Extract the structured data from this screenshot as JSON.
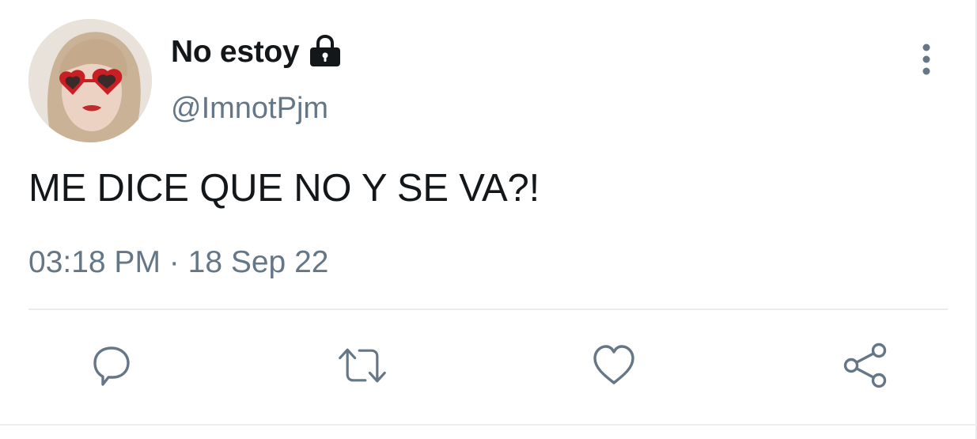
{
  "user": {
    "display_name": "No estoy",
    "handle": "@ImnotPjm",
    "protected_icon": "lock-icon",
    "avatar": "avatar-photo"
  },
  "tweet": {
    "text": "ME DICE QUE NO Y SE VA?!",
    "time": "03:18 PM",
    "separator": "·",
    "date": "18 Sep 22"
  },
  "actions": {
    "reply_icon": "reply-icon",
    "retweet_icon": "retweet-icon",
    "like_icon": "heart-icon",
    "share_icon": "share-icon",
    "more_icon": "more-vertical-icon"
  },
  "colors": {
    "primary_text": "#14171a",
    "secondary_text": "#657786",
    "divider": "#e6ecf0"
  }
}
